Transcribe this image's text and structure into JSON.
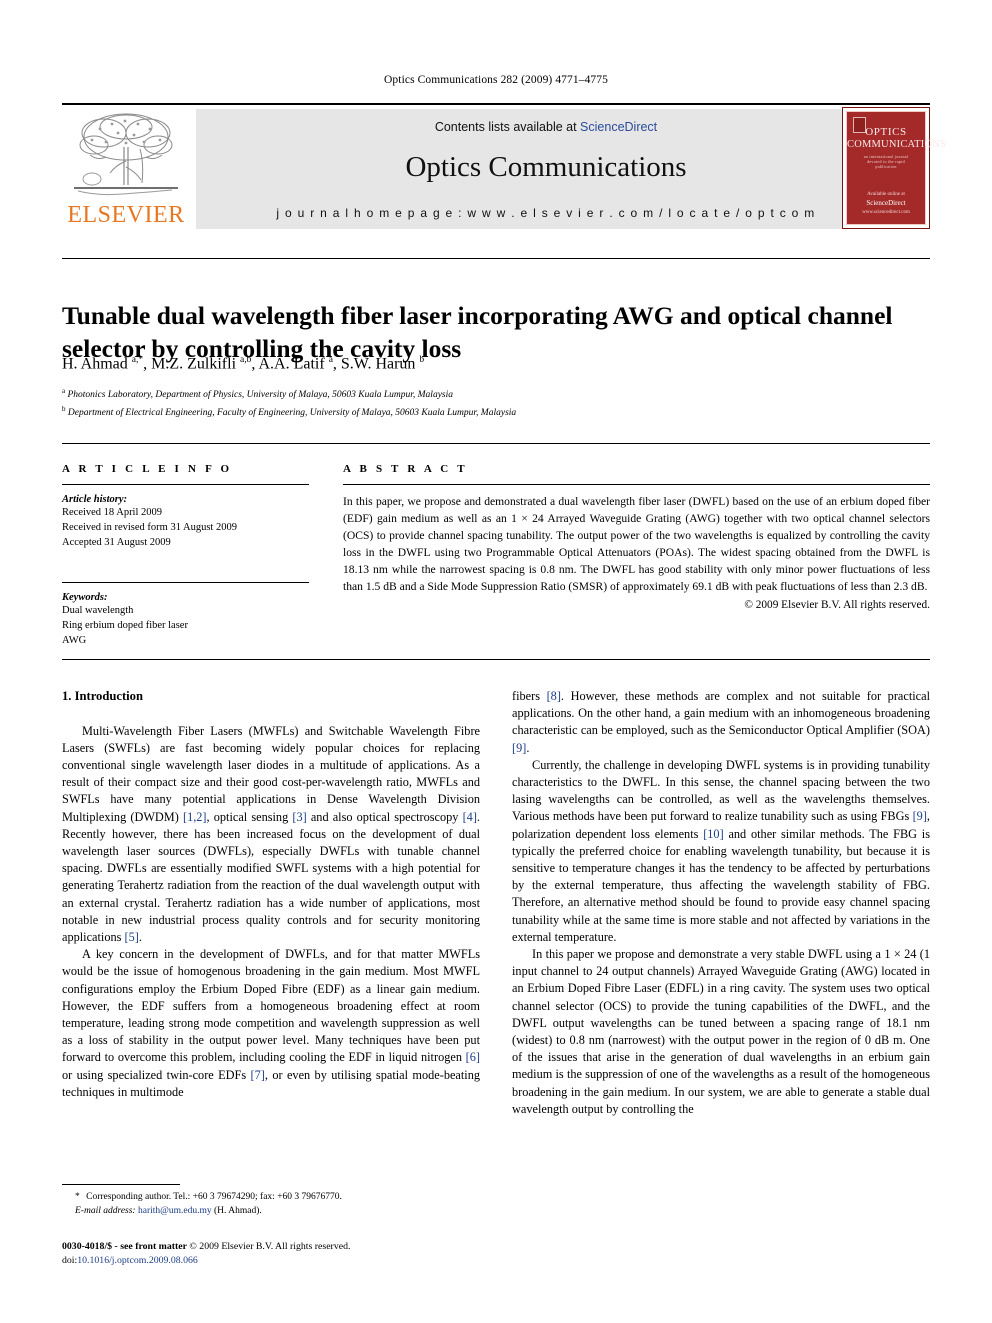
{
  "running_head": "Optics Communications 282 (2009) 4771–4775",
  "masthead": {
    "publisher_logo_text": "ELSEVIER",
    "contents_prefix": "Contents lists available at ",
    "contents_link": "ScienceDirect",
    "journal_title": "Optics Communications",
    "homepage_line": "j o u r n a l   h o m e p a g e :   w w w . e l s e v i e r . c o m / l o c a t e / o p t c o m",
    "cover": {
      "line1": "OPTICS",
      "line2": "COMMUNICATIONS",
      "subline": "an international journal devoted to the rapid publication",
      "footer_small": "Available online at",
      "footer_brand": "ScienceDirect",
      "footer_tiny": "www.sciencedirect.com",
      "accent_color": "#a42a2a"
    }
  },
  "article": {
    "title": "Tunable dual wavelength fiber laser incorporating AWG and optical channel selector by controlling the cavity loss",
    "authors_html": "H. Ahmad <sup>a,*</sup>, M.Z. Zulkifli <sup>a,b</sup>, A.A. Latif <sup>a</sup>, S.W. Harun <sup>b</sup>",
    "affiliation_a": "Photonics Laboratory, Department of Physics, University of Malaya, 50603 Kuala Lumpur, Malaysia",
    "affiliation_b": "Department of Electrical Engineering, Faculty of Engineering, University of Malaya, 50603 Kuala Lumpur, Malaysia"
  },
  "article_info": {
    "heading": "A R T I C L E   I N F O",
    "history_label": "Article history:",
    "history": [
      "Received 18 April 2009",
      "Received in revised form 31 August 2009",
      "Accepted 31 August 2009"
    ],
    "keywords_label": "Keywords:",
    "keywords": [
      "Dual wavelength",
      "Ring erbium doped fiber laser",
      "AWG"
    ]
  },
  "abstract": {
    "heading": "A B S T R A C T",
    "text": "In this paper, we propose and demonstrated a dual wavelength fiber laser (DWFL) based on the use of an erbium doped fiber (EDF) gain medium as well as an 1 × 24 Arrayed Waveguide Grating (AWG) together with two optical channel selectors (OCS) to provide channel spacing tunability. The output power of the two wavelengths is equalized by controlling the cavity loss in the DWFL using two Programmable Optical Attenuators (POAs). The widest spacing obtained from the DWFL is 18.13 nm while the narrowest spacing is 0.8 nm. The DWFL has good stability with only minor power fluctuations of less than 1.5 dB and a Side Mode Suppression Ratio (SMSR) of approximately 69.1 dB with peak fluctuations of less than 2.3 dB.",
    "copyright": "© 2009 Elsevier B.V. All rights reserved."
  },
  "body": {
    "section_heading": "1. Introduction",
    "left_paragraphs_html": [
      "Multi-Wavelength Fiber Lasers (MWFLs) and Switchable Wavelength Fibre Lasers (SWFLs) are fast becoming widely popular choices for replacing conventional single wavelength laser diodes in a multitude of applications. As a result of their compact size and their good cost-per-wavelength ratio, MWFLs and SWFLs have many potential applications in Dense Wavelength Division Multiplexing (DWDM) <span class=\"ref\">[1,2]</span>, optical sensing <span class=\"ref\">[3]</span> and also optical spectroscopy <span class=\"ref\">[4]</span>. Recently however, there has been increased focus on the development of dual wavelength laser sources (DWFLs), especially DWFLs with tunable channel spacing. DWFLs are essentially modified SWFL systems with a high potential for generating Terahertz radiation from the reaction of the dual wavelength output with an external crystal. Terahertz radiation has a wide number of applications, most notable in new industrial process quality controls and for security monitoring applications <span class=\"ref\">[5]</span>.",
      "A key concern in the development of DWFLs, and for that matter MWFLs would be the issue of homogenous broadening in the gain medium. Most MWFL configurations employ the Erbium Doped Fibre (EDF) as a linear gain medium. However, the EDF suffers from a homogeneous broadening effect at room temperature, leading strong mode competition and wavelength suppression as well as a loss of stability in the output power level. Many techniques have been put forward to overcome this problem, including cooling the EDF in liquid nitrogen <span class=\"ref\">[6]</span> or using specialized twin-core EDFs <span class=\"ref\">[7]</span>, or even by utilising spatial mode-beating techniques in multimode"
    ],
    "right_paragraphs_html": [
      "fibers <span class=\"ref\">[8]</span>. However, these methods are complex and not suitable for practical applications. On the other hand, a gain medium with an inhomogeneous broadening characteristic can be employed, such as the Semiconductor Optical Amplifier (SOA) <span class=\"ref\">[9]</span>.",
      "Currently, the challenge in developing DWFL systems is in providing tunability characteristics to the DWFL. In this sense, the channel spacing between the two lasing wavelengths can be controlled, as well as the wavelengths themselves. Various methods have been put forward to realize tunability such as using FBGs <span class=\"ref\">[9]</span>, polarization dependent loss elements <span class=\"ref\">[10]</span> and other similar methods. The FBG is typically the preferred choice for enabling wavelength tunability, but because it is sensitive to temperature changes it has the tendency to be affected by perturbations by the external temperature, thus affecting the wavelength stability of FBG. Therefore, an alternative method should be found to provide easy channel spacing tunability while at the same time is more stable and not affected by variations in the external temperature.",
      "In this paper we propose and demonstrate a very stable DWFL using a 1 × 24 (1 input channel to 24 output channels) Arrayed Waveguide Grating (AWG) located in an Erbium Doped Fibre Laser (EDFL) in a ring cavity. The system uses two optical channel selector (OCS) to provide the tuning capabilities of the DWFL, and the DWFL output wavelengths can be tuned between a spacing range of 18.1 nm (widest) to 0.8 nm (narrowest) with the output power in the region of 0 dB m. One of the issues that arise in the generation of dual wavelengths in an erbium gain medium is the suppression of one of the wavelengths as a result of the homogeneous broadening in the gain medium. In our system, we are able to generate a stable dual wavelength output by controlling the"
    ]
  },
  "footnote": {
    "corresponding_html": "<span class=\"star\">*</span> Corresponding author. Tel.: +60 3 79674290; fax: +60 3 79676770.",
    "email_label": "E-mail address:",
    "email": "harith@um.edu.my",
    "email_owner": "(H. Ahmad)."
  },
  "imprint": {
    "issn_line_html": "<span class=\"bold\">0030-4018/$ - see front matter</span> © 2009 Elsevier B.V. All rights reserved.",
    "doi_label": "doi:",
    "doi_value": "10.1016/j.optcom.2009.08.066"
  }
}
